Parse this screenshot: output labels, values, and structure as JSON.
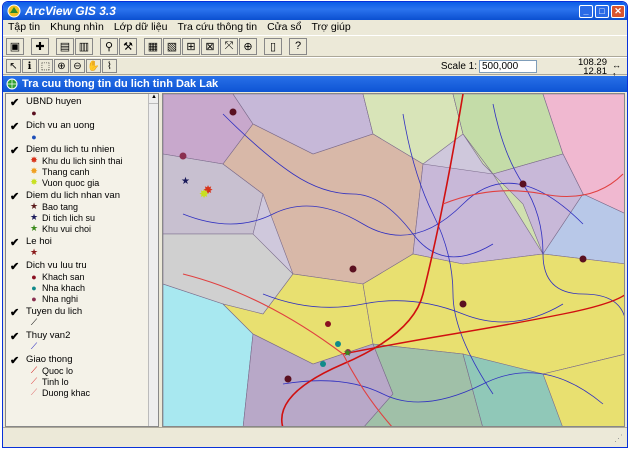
{
  "window": {
    "title": "ArcView GIS 3.3"
  },
  "menu": [
    "Tập tin",
    "Khung nhìn",
    "Lớp dữ liệu",
    "Tra cứu thông tin",
    "Cửa sổ",
    "Trợ giúp"
  ],
  "scale": {
    "label": "Scale 1:",
    "value": "500,000"
  },
  "coords": {
    "x": "108.29",
    "y": "12.81"
  },
  "view": {
    "title": "Tra cuu thong tin du lich tinh Dak Lak"
  },
  "legend": [
    {
      "name": "UBND huyen",
      "items": [
        {
          "label": "",
          "glyph": "●",
          "color": "#5a1020"
        }
      ]
    },
    {
      "name": "Dich vu an uong",
      "items": [
        {
          "label": "",
          "glyph": "●",
          "color": "#1d4fb8"
        }
      ]
    },
    {
      "name": "Diem du lich tu nhien",
      "items": [
        {
          "label": "Khu du lich sinh thai",
          "glyph": "✸",
          "color": "#d8331a"
        },
        {
          "label": "Thang canh",
          "glyph": "✸",
          "color": "#f0a020"
        },
        {
          "label": "Vuon quoc gia",
          "glyph": "✸",
          "color": "#c8e020"
        }
      ]
    },
    {
      "name": "Diem du lich nhan van",
      "items": [
        {
          "label": "Bao tang",
          "glyph": "★",
          "color": "#5a1a1a"
        },
        {
          "label": "Di tich lich su",
          "glyph": "★",
          "color": "#1a1a5a"
        },
        {
          "label": "Khu vui choi",
          "glyph": "★",
          "color": "#3a8a1a"
        }
      ]
    },
    {
      "name": "Le hoi",
      "items": [
        {
          "label": "",
          "glyph": "★",
          "color": "#8a1a1a"
        }
      ]
    },
    {
      "name": "Dich vu luu tru",
      "items": [
        {
          "label": "Khach san",
          "glyph": "●",
          "color": "#8a1020"
        },
        {
          "label": "Nha khach",
          "glyph": "●",
          "color": "#108a8a"
        },
        {
          "label": "Nha nghi",
          "glyph": "●",
          "color": "#8a3050"
        }
      ]
    },
    {
      "name": "Tuyen du lich",
      "items": [
        {
          "label": "",
          "glyph": "⟋",
          "color": "#000000"
        }
      ]
    },
    {
      "name": "Thuy van2",
      "items": [
        {
          "label": "",
          "glyph": "⟋",
          "color": "#2020c0"
        }
      ]
    },
    {
      "name": "Giao thong",
      "items": [
        {
          "label": "Quoc lo",
          "glyph": "⟋",
          "color": "#d01010"
        },
        {
          "label": "Tinh lo",
          "glyph": "⟋",
          "color": "#e04040"
        },
        {
          "label": "Duong khac",
          "glyph": "⟋",
          "color": "#e07070"
        }
      ]
    }
  ]
}
